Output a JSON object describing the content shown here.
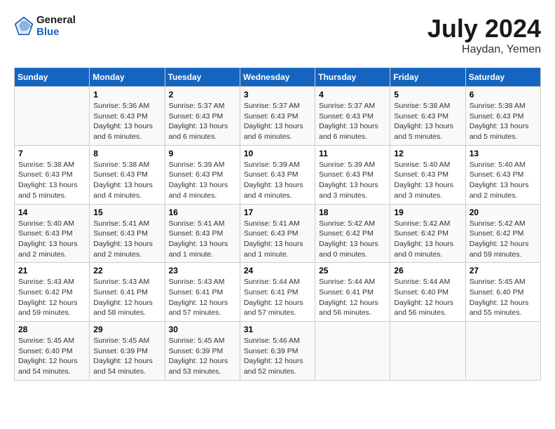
{
  "header": {
    "logo_line1": "General",
    "logo_line2": "Blue",
    "month": "July 2024",
    "location": "Haydan, Yemen"
  },
  "days_of_week": [
    "Sunday",
    "Monday",
    "Tuesday",
    "Wednesday",
    "Thursday",
    "Friday",
    "Saturday"
  ],
  "weeks": [
    [
      {
        "day": "",
        "info": ""
      },
      {
        "day": "1",
        "info": "Sunrise: 5:36 AM\nSunset: 6:43 PM\nDaylight: 13 hours and 6 minutes."
      },
      {
        "day": "2",
        "info": "Sunrise: 5:37 AM\nSunset: 6:43 PM\nDaylight: 13 hours and 6 minutes."
      },
      {
        "day": "3",
        "info": "Sunrise: 5:37 AM\nSunset: 6:43 PM\nDaylight: 13 hours and 6 minutes."
      },
      {
        "day": "4",
        "info": "Sunrise: 5:37 AM\nSunset: 6:43 PM\nDaylight: 13 hours and 6 minutes."
      },
      {
        "day": "5",
        "info": "Sunrise: 5:38 AM\nSunset: 6:43 PM\nDaylight: 13 hours and 5 minutes."
      },
      {
        "day": "6",
        "info": "Sunrise: 5:38 AM\nSunset: 6:43 PM\nDaylight: 13 hours and 5 minutes."
      }
    ],
    [
      {
        "day": "7",
        "info": "Sunrise: 5:38 AM\nSunset: 6:43 PM\nDaylight: 13 hours and 5 minutes."
      },
      {
        "day": "8",
        "info": "Sunrise: 5:38 AM\nSunset: 6:43 PM\nDaylight: 13 hours and 4 minutes."
      },
      {
        "day": "9",
        "info": "Sunrise: 5:39 AM\nSunset: 6:43 PM\nDaylight: 13 hours and 4 minutes."
      },
      {
        "day": "10",
        "info": "Sunrise: 5:39 AM\nSunset: 6:43 PM\nDaylight: 13 hours and 4 minutes."
      },
      {
        "day": "11",
        "info": "Sunrise: 5:39 AM\nSunset: 6:43 PM\nDaylight: 13 hours and 3 minutes."
      },
      {
        "day": "12",
        "info": "Sunrise: 5:40 AM\nSunset: 6:43 PM\nDaylight: 13 hours and 3 minutes."
      },
      {
        "day": "13",
        "info": "Sunrise: 5:40 AM\nSunset: 6:43 PM\nDaylight: 13 hours and 2 minutes."
      }
    ],
    [
      {
        "day": "14",
        "info": "Sunrise: 5:40 AM\nSunset: 6:43 PM\nDaylight: 13 hours and 2 minutes."
      },
      {
        "day": "15",
        "info": "Sunrise: 5:41 AM\nSunset: 6:43 PM\nDaylight: 13 hours and 2 minutes."
      },
      {
        "day": "16",
        "info": "Sunrise: 5:41 AM\nSunset: 6:43 PM\nDaylight: 13 hours and 1 minute."
      },
      {
        "day": "17",
        "info": "Sunrise: 5:41 AM\nSunset: 6:43 PM\nDaylight: 13 hours and 1 minute."
      },
      {
        "day": "18",
        "info": "Sunrise: 5:42 AM\nSunset: 6:42 PM\nDaylight: 13 hours and 0 minutes."
      },
      {
        "day": "19",
        "info": "Sunrise: 5:42 AM\nSunset: 6:42 PM\nDaylight: 13 hours and 0 minutes."
      },
      {
        "day": "20",
        "info": "Sunrise: 5:42 AM\nSunset: 6:42 PM\nDaylight: 12 hours and 59 minutes."
      }
    ],
    [
      {
        "day": "21",
        "info": "Sunrise: 5:43 AM\nSunset: 6:42 PM\nDaylight: 12 hours and 59 minutes."
      },
      {
        "day": "22",
        "info": "Sunrise: 5:43 AM\nSunset: 6:41 PM\nDaylight: 12 hours and 58 minutes."
      },
      {
        "day": "23",
        "info": "Sunrise: 5:43 AM\nSunset: 6:41 PM\nDaylight: 12 hours and 57 minutes."
      },
      {
        "day": "24",
        "info": "Sunrise: 5:44 AM\nSunset: 6:41 PM\nDaylight: 12 hours and 57 minutes."
      },
      {
        "day": "25",
        "info": "Sunrise: 5:44 AM\nSunset: 6:41 PM\nDaylight: 12 hours and 56 minutes."
      },
      {
        "day": "26",
        "info": "Sunrise: 5:44 AM\nSunset: 6:40 PM\nDaylight: 12 hours and 56 minutes."
      },
      {
        "day": "27",
        "info": "Sunrise: 5:45 AM\nSunset: 6:40 PM\nDaylight: 12 hours and 55 minutes."
      }
    ],
    [
      {
        "day": "28",
        "info": "Sunrise: 5:45 AM\nSunset: 6:40 PM\nDaylight: 12 hours and 54 minutes."
      },
      {
        "day": "29",
        "info": "Sunrise: 5:45 AM\nSunset: 6:39 PM\nDaylight: 12 hours and 54 minutes."
      },
      {
        "day": "30",
        "info": "Sunrise: 5:45 AM\nSunset: 6:39 PM\nDaylight: 12 hours and 53 minutes."
      },
      {
        "day": "31",
        "info": "Sunrise: 5:46 AM\nSunset: 6:39 PM\nDaylight: 12 hours and 52 minutes."
      },
      {
        "day": "",
        "info": ""
      },
      {
        "day": "",
        "info": ""
      },
      {
        "day": "",
        "info": ""
      }
    ]
  ]
}
